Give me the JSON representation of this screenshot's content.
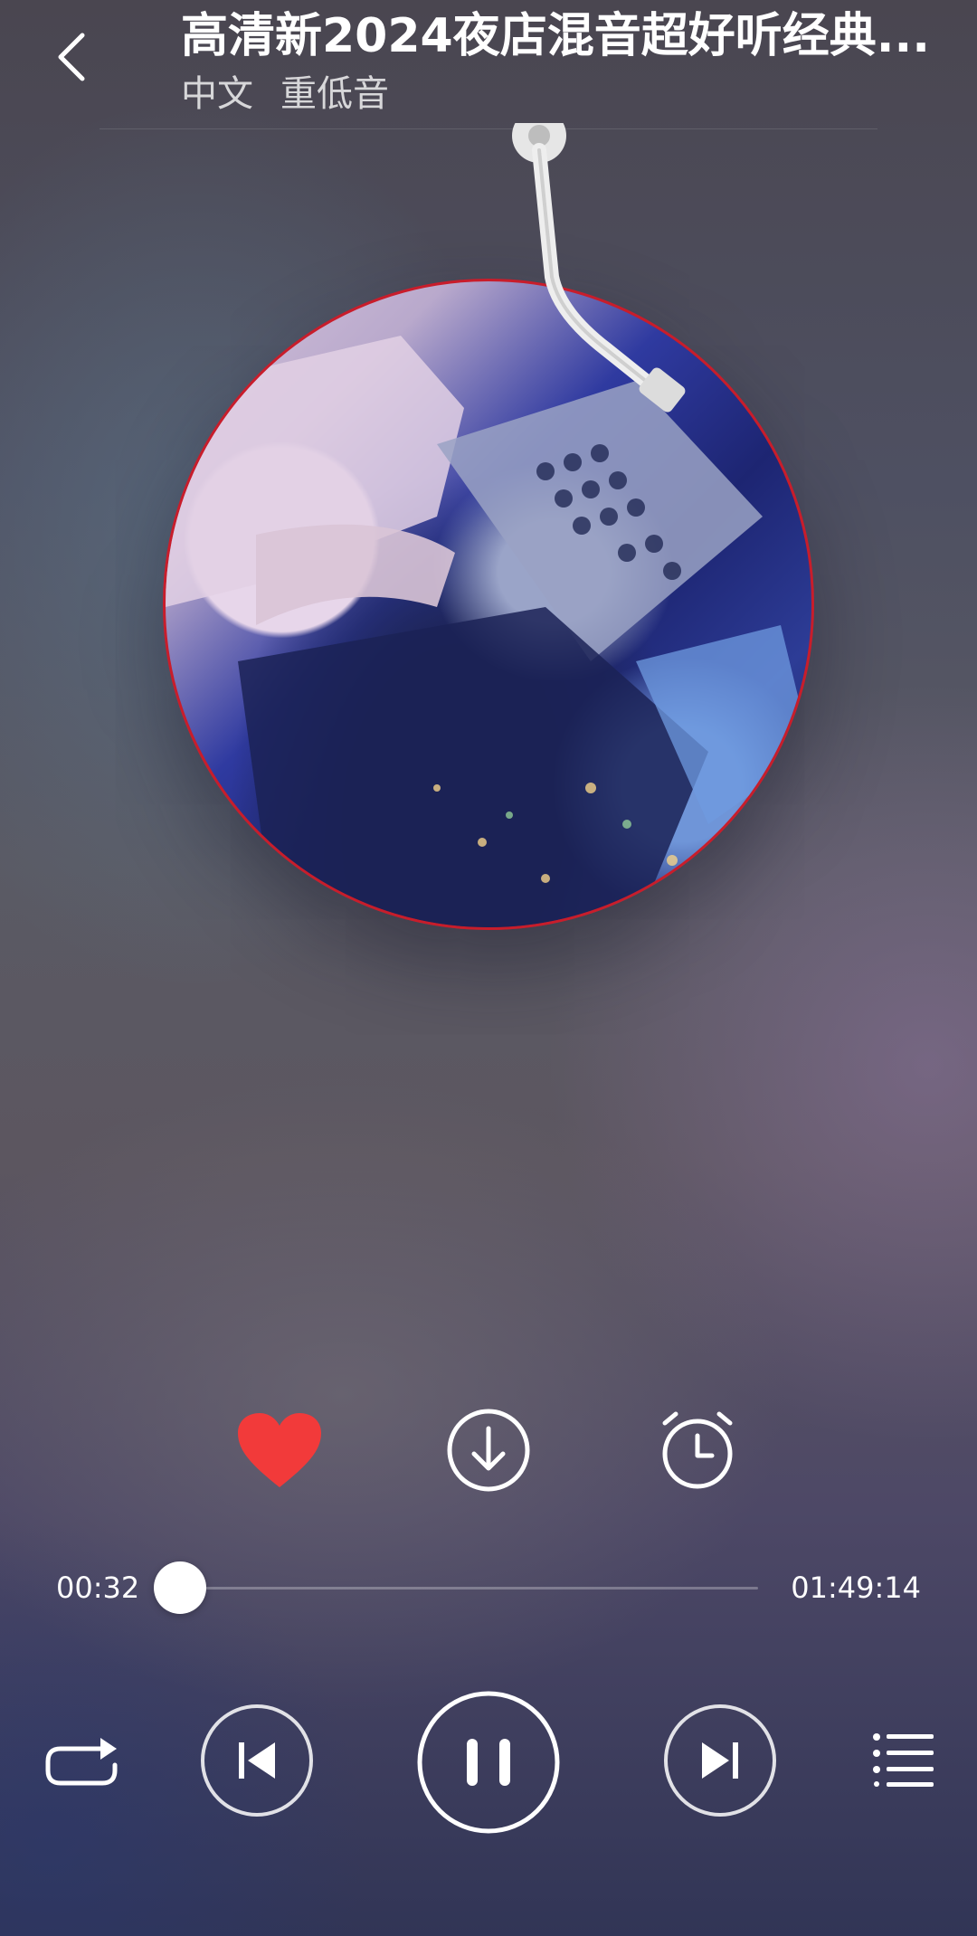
{
  "header": {
    "title": "高清新2024夜店混音超好听经典...",
    "tags": [
      "中文",
      "重低音"
    ]
  },
  "icons": {
    "back": "chevron-left-icon",
    "favorite": "heart-icon",
    "download": "download-circle-icon",
    "timer": "alarm-clock-icon",
    "repeat": "repeat-icon",
    "previous": "skip-previous-icon",
    "pause": "pause-icon",
    "next": "skip-next-icon",
    "playlist": "playlist-icon"
  },
  "colors": {
    "accent_red": "#f23a3a",
    "disc_border": "#c81d2b"
  },
  "actions": {
    "favorited": true
  },
  "player": {
    "current_time": "00:32",
    "total_time": "01:49:14",
    "progress_fraction": 0.0049
  }
}
